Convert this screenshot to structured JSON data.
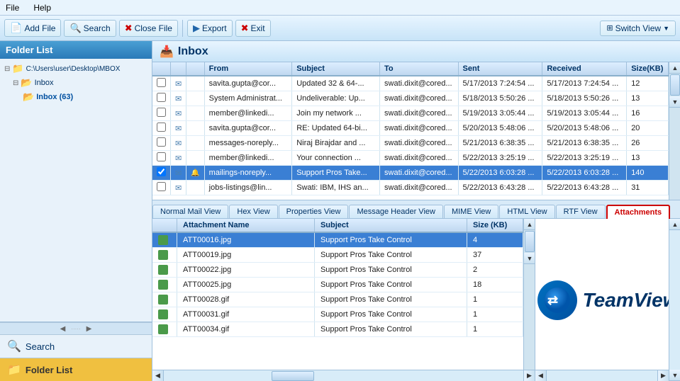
{
  "menubar": {
    "file": "File",
    "help": "Help"
  },
  "toolbar": {
    "add_file": "Add File",
    "search": "Search",
    "close_file": "Close File",
    "export": "Export",
    "exit": "Exit",
    "switch_view": "Switch View"
  },
  "sidebar": {
    "title": "Folder List",
    "path": "C:\\Users\\user\\Desktop\\MBOX",
    "inbox_label": "Inbox (63)",
    "search_label": "Search",
    "folder_list_label": "Folder List"
  },
  "inbox": {
    "title": "Inbox",
    "columns": {
      "from": "From",
      "subject": "Subject",
      "to": "To",
      "sent": "Sent",
      "received": "Received",
      "size_kb": "Size(KB)"
    },
    "emails": [
      {
        "from": "savita.gupta@cor...",
        "subject": "Updated 32 & 64-...",
        "to": "swati.dixit@cored...",
        "sent": "5/17/2013 7:24:54 ...",
        "received": "5/17/2013 7:24:54 ...",
        "size": "12",
        "selected": false
      },
      {
        "from": "System Administrat...",
        "subject": "Undeliverable: Up...",
        "to": "swati.dixit@cored...",
        "sent": "5/18/2013 5:50:26 ...",
        "received": "5/18/2013 5:50:26 ...",
        "size": "13",
        "selected": false
      },
      {
        "from": "member@linkedi...",
        "subject": "Join my network ...",
        "to": "swati.dixit@cored...",
        "sent": "5/19/2013 3:05:44 ...",
        "received": "5/19/2013 3:05:44 ...",
        "size": "16",
        "selected": false
      },
      {
        "from": "savita.gupta@cor...",
        "subject": "RE: Updated 64-bi...",
        "to": "swati.dixit@cored...",
        "sent": "5/20/2013 5:48:06 ...",
        "received": "5/20/2013 5:48:06 ...",
        "size": "20",
        "selected": false
      },
      {
        "from": "messages-noreply...",
        "subject": "Niraj Birajdar and ...",
        "to": "swati.dixit@cored...",
        "sent": "5/21/2013 6:38:35 ...",
        "received": "5/21/2013 6:38:35 ...",
        "size": "26",
        "selected": false
      },
      {
        "from": "member@linkedi...",
        "subject": "Your connection ...",
        "to": "swati.dixit@cored...",
        "sent": "5/22/2013 3:25:19 ...",
        "received": "5/22/2013 3:25:19 ...",
        "size": "13",
        "selected": false
      },
      {
        "from": "mailings-noreply...",
        "subject": "Support Pros Take...",
        "to": "swati.dixit@cored...",
        "sent": "5/22/2013 6:03:28 ...",
        "received": "5/22/2013 6:03:28 ...",
        "size": "140",
        "selected": true
      },
      {
        "from": "jobs-listings@lin...",
        "subject": "Swati: IBM, IHS an...",
        "to": "swati.dixit@cored...",
        "sent": "5/22/2013 6:43:28 ...",
        "received": "5/22/2013 6:43:28 ...",
        "size": "31",
        "selected": false
      }
    ]
  },
  "view_tabs": [
    {
      "id": "normal",
      "label": "Normal Mail View",
      "active": false
    },
    {
      "id": "hex",
      "label": "Hex View",
      "active": false
    },
    {
      "id": "properties",
      "label": "Properties View",
      "active": false
    },
    {
      "id": "message_header",
      "label": "Message Header View",
      "active": false
    },
    {
      "id": "mime",
      "label": "MIME View",
      "active": false
    },
    {
      "id": "html",
      "label": "HTML View",
      "active": false
    },
    {
      "id": "rtf",
      "label": "RTF View",
      "active": false
    },
    {
      "id": "attachments",
      "label": "Attachments",
      "active": true
    }
  ],
  "attachments": {
    "columns": {
      "name": "Attachment Name",
      "subject": "Subject",
      "size": "Size (KB)"
    },
    "items": [
      {
        "name": "ATT00016.jpg",
        "subject": "Support Pros Take Control",
        "size": "4",
        "selected": true
      },
      {
        "name": "ATT00019.jpg",
        "subject": "Support Pros Take Control",
        "size": "37",
        "selected": false
      },
      {
        "name": "ATT00022.jpg",
        "subject": "Support Pros Take Control",
        "size": "2",
        "selected": false
      },
      {
        "name": "ATT00025.jpg",
        "subject": "Support Pros Take Control",
        "size": "18",
        "selected": false
      },
      {
        "name": "ATT00028.gif",
        "subject": "Support Pros Take Control",
        "size": "1",
        "selected": false
      },
      {
        "name": "ATT00031.gif",
        "subject": "Support Pros Take Control",
        "size": "1",
        "selected": false
      },
      {
        "name": "ATT00034.gif",
        "subject": "Support Pros Take Control",
        "size": "1",
        "selected": false
      }
    ]
  },
  "teamviewer": {
    "text": "TeamView"
  }
}
